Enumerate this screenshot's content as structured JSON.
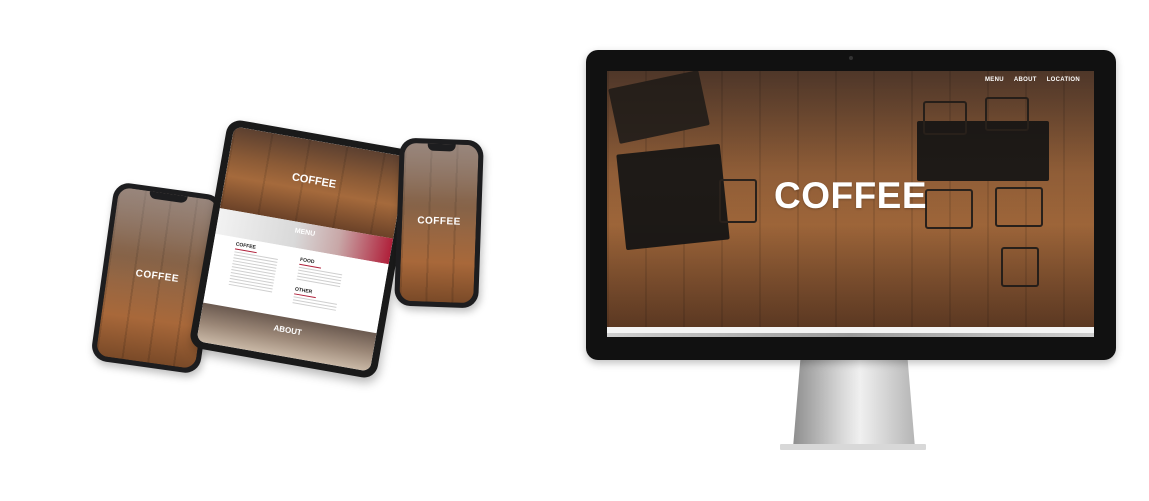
{
  "brand": {
    "hero_word": "COFFEE",
    "accent": "#b0203a"
  },
  "monitor": {
    "nav": [
      "MENU",
      "ABOUT",
      "LOCATION"
    ],
    "hero_title": "COFFEE"
  },
  "tablet": {
    "hero_title": "COFFEE",
    "section_title": "MENU",
    "columns": [
      {
        "heading": "COFFEE"
      },
      {
        "heading": "FOOD"
      },
      {
        "heading": "OTHER"
      }
    ],
    "about_title": "ABOUT"
  },
  "phone_left": {
    "hero_title": "COFFEE"
  },
  "phone_right": {
    "hero_title": "COFFEE"
  }
}
